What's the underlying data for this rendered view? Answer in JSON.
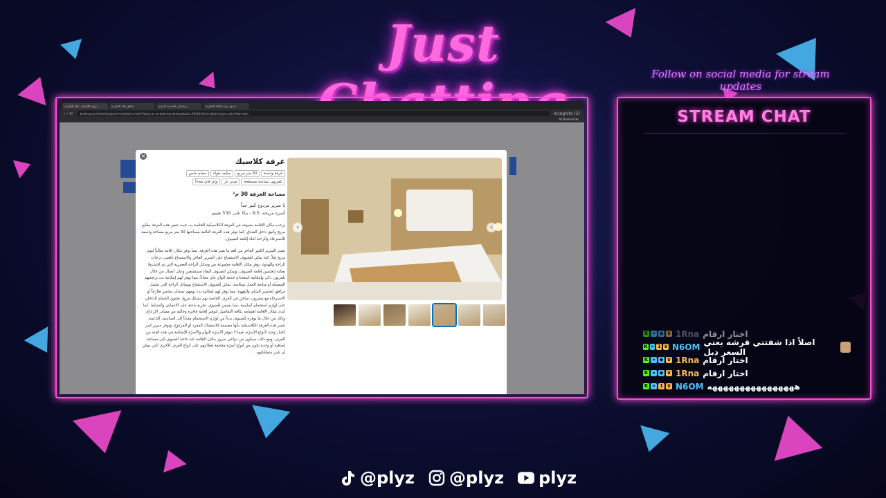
{
  "overlay": {
    "title": "Just Chatting",
    "follow_line": "Follow on social media for stream updates",
    "colors": {
      "neon_pink": "#ff4fd8",
      "neon_blue": "#4fc3ff",
      "bg": "#0d0f35"
    }
  },
  "browser": {
    "tabs": [
      {
        "label": "غرفة كلاسيك - مكة المكرمة"
      },
      {
        "label": "فنادق مكة المكرمة"
      },
      {
        "label": "رحلة إلى المسجد الحرام"
      },
      {
        "label": "فندق جراند المكة المكرمة"
      }
    ],
    "url": "booking.com/hotel/sa/grand-makkah.ar.html?label=ar-sa-booking-desktop&aid=304142&sid=&dest_type=city#tab-main",
    "incognito_label": "Incognito (2)",
    "bookmarks_label": "All Bookmarks"
  },
  "room_modal": {
    "close_label": "×",
    "title": "غرفة كلاسيك",
    "facilities": [
      {
        "icon": "bed-icon",
        "label": "غرفة واحدة"
      },
      {
        "icon": "size-icon",
        "label": "30 متر مربع"
      },
      {
        "icon": "ac-icon",
        "label": "مكيف هواء"
      },
      {
        "icon": "bath-icon",
        "label": "حمام خاص"
      },
      {
        "icon": "tv-icon",
        "label": "تلفزيون بشاشة مسطحة"
      },
      {
        "icon": "minibar-icon",
        "label": "ميني بار"
      },
      {
        "icon": "wifi-icon",
        "label": "واي فاي مجاناً"
      }
    ],
    "size_heading": "مساحة الغرفة 30 م²",
    "bed": "1 سرير مزدوج كبير جداً",
    "rating": "أسرة مريحة، 8.5 - بناءً على 530 تقييم",
    "description_1": "يرحب مكان الإقامة بضيوفه في الغرفة الكلاسيكية الخاصة به، حيث تتميز هذه الغرفة بطابع مريح وأنيق داخل الفندق، كما توفر هذه الغرفة البالغة مساحتها 30 متر مربع مساحة واسعة للاسترخاء والراحة أثناء إقامة الضيوف.",
    "description_2": "يتميز السرير الكبير الفاخر من أهم ما يميز هذه الغرفة، مما يوفر مكان إقامة مثالياً لنوم مريح ليلاً، كما يمكن للضيوف الاستمتاع على السرير الفاخر والاستمتاع بأقصى درجات الراحة والهدوء. يوفر مكان الإقامة مجموعة من وسائل الراحة العصرية التي تم اختيارها بعناية لتحسين إقامة الضيوف، ويمكن للضيوف البقاء مستمتعين وعلى اتصال من خلال تلفزيون ذكي وإمكانية استخدام خدمة الواي فاي مجاناً، مما يوفر لهم إمكانية بث برامجهم المفضلة أو متابعة العمل بسلاسة. يمكن للضيوف الاستمتاع بوسائل الراحة التي تشمل مرافق لتحضير الشاي والقهوة، مما يوفر لهم إمكانية بدء يومهم بمنجان محضر طازجاً أو الاسترخاء مع مشروب ساخن في الغرف الخاصة بهم بشكل مريح. يحتوي الحمام الداخلي على لوازم استحمام أساسية، مما يضمن للضيوف تجربة باعثة على الانتعاش والنشاط. كما أبدى مكان الإقامة اهتمامه بكافة التفاصيل لتوفير إقامة فاخرة وخالية من مصادر الإزعاج، وذلك من خلال ما يوفره للضيوف بدءاً من لوازم الاستحمام مجاناً إلى المناشف الناعمة. تتميز هذه الغرفة الكلاسيكية بأنها مصممة للاستقبال المفرد أو المزدوج، وتوفر سرير كبير كخيار وحيد لأنواع الأسرّة، فيما لا تتوفر الأسرّة التوأم والأسرّة الإضافية في هذه الفئة من الغرف. ومع ذلك، سيكون من دواعي سرور مكان الإقامة عند حاجة الضيوف إلى مساحة إضافية أو وحدة تكون من أنواع أسرّة مختلفة إطلاعهم على أنواع الغرف الأخرى التي يمكن أن تلبي متطلباتهم.",
    "photo_count": 7,
    "selected_thumb_index": 2
  },
  "chat": {
    "title": "STREAM CHAT",
    "messages": [
      {
        "user": "1Rna",
        "text": "اختار ارقام",
        "user_color": "#8a8aa0",
        "dim": true,
        "badges": [
          "K",
          "»",
          "◆",
          "♛"
        ]
      },
      {
        "user": "N6OM",
        "text": "اصلاً اذا شفتني قرشه يعني السعر دبل",
        "user_color": "#4fc3ff",
        "dim": false,
        "badges": [
          "K",
          "»",
          "1",
          "♛"
        ],
        "sticker": true
      },
      {
        "user": "1Rna",
        "text": "اختار ارقام",
        "user_color": "#ffb84d",
        "dim": false,
        "badges": [
          "K",
          "»",
          "◆",
          "♛"
        ]
      },
      {
        "user": "1Rna",
        "text": "اختار ارقام",
        "user_color": "#ffb84d",
        "dim": false,
        "badges": [
          "K",
          "»",
          "◆",
          "♛"
        ]
      },
      {
        "user": "N6OM",
        "text": "ههههههههههههههههه",
        "user_color": "#4fc3ff",
        "dim": false,
        "badges": [
          "K",
          "»",
          "1",
          "♛"
        ]
      }
    ]
  },
  "socials": [
    {
      "icon": "tiktok-icon",
      "handle": "@plyz"
    },
    {
      "icon": "instagram-icon",
      "handle": "@plyz"
    },
    {
      "icon": "youtube-icon",
      "handle": "plyz"
    }
  ]
}
